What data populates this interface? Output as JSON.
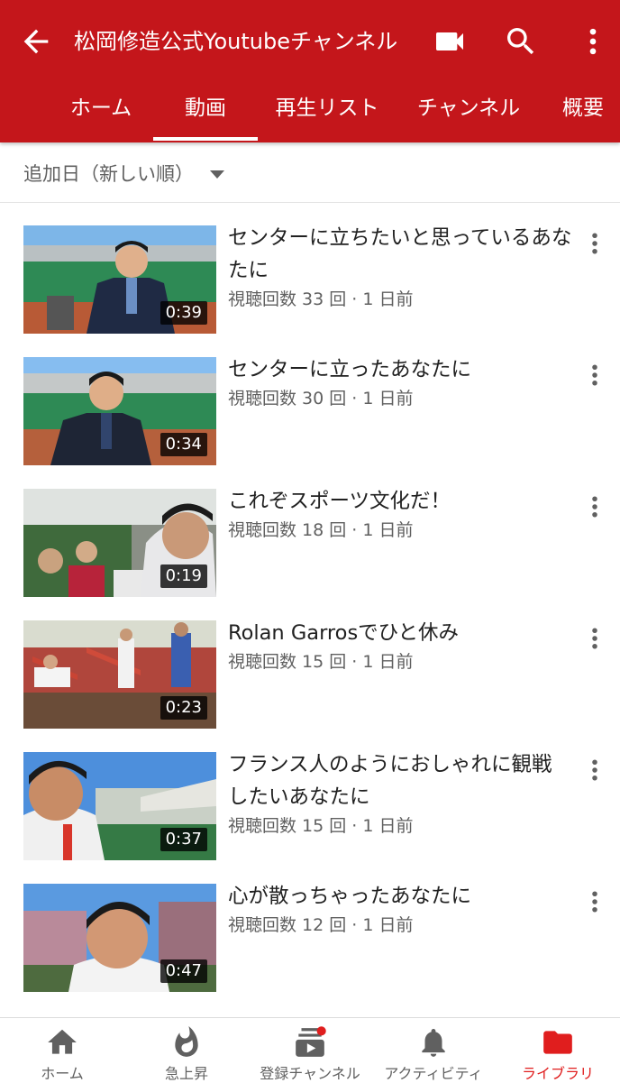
{
  "header": {
    "title": "松岡修造公式Youtubeチャンネル",
    "back_icon": "arrow-back-icon",
    "actions": [
      "videocam-icon",
      "search-icon",
      "more-vert-icon"
    ],
    "background": "#c4161b"
  },
  "tabs": [
    {
      "label": "ホーム",
      "active": false
    },
    {
      "label": "動画",
      "active": true
    },
    {
      "label": "再生リスト",
      "active": false
    },
    {
      "label": "チャンネル",
      "active": false
    },
    {
      "label": "概要",
      "active": false
    }
  ],
  "sort": {
    "label": "追加日（新しい順）"
  },
  "videos": [
    {
      "title": "センターに立ちたいと思っているあなたに",
      "meta": "視聴回数 33 回 · 1 日前",
      "duration": "0:39"
    },
    {
      "title": "センターに立ったあなたに",
      "meta": "視聴回数 30 回 · 1 日前",
      "duration": "0:34"
    },
    {
      "title": "これぞスポーツ文化だ！",
      "meta": "視聴回数 18 回 · 1 日前",
      "duration": "0:19"
    },
    {
      "title": "Rolan Garrosでひと休み",
      "meta": "視聴回数 15 回 · 1 日前",
      "duration": "0:23"
    },
    {
      "title": "フランス人のようにおしゃれに観戦したいあなたに",
      "meta": "視聴回数 15 回 · 1 日前",
      "duration": "0:37"
    },
    {
      "title": "心が散っちゃったあなたに",
      "meta": "視聴回数 12 回 · 1 日前",
      "duration": "0:47"
    }
  ],
  "bottom_nav": [
    {
      "label": "ホーム",
      "icon": "home-icon",
      "active": false
    },
    {
      "label": "急上昇",
      "icon": "trending-fire-icon",
      "active": false
    },
    {
      "label": "登録チャンネル",
      "icon": "subscriptions-icon",
      "active": false
    },
    {
      "label": "アクティビティ",
      "icon": "bell-icon",
      "active": false
    },
    {
      "label": "ライブラリ",
      "icon": "folder-icon",
      "active": true
    }
  ],
  "colors": {
    "accent": "#c4161b",
    "active_nav": "#e01e1e",
    "secondary_text": "#606060"
  }
}
